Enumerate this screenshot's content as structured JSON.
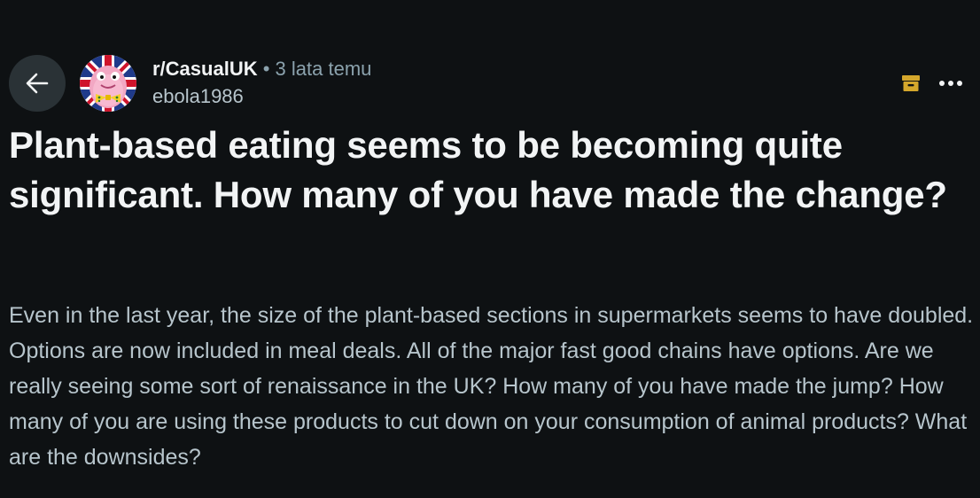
{
  "post": {
    "subreddit": "r/CasualUK",
    "separator": "•",
    "time": "3 lata temu",
    "author": "ebola1986",
    "title": "Plant-based eating seems to be becoming quite significant. How many of you have made the change?",
    "body": "Even in the last year, the size of the plant-based sections in supermarkets seems to have doubled. Options are now included in meal deals. All of the major fast good chains have options. Are we really seeing some sort of renaissance in the UK? How many of you have made the jump? How many of you are using these products to cut down on your consumption of animal products? What are the downsides?"
  },
  "icons": {
    "back": "arrow-left-icon",
    "archive": "archive-icon",
    "more": "more-horizontal-icon"
  },
  "colors": {
    "background": "#0e1113",
    "archive_accent": "#d4a72c",
    "back_button_bg": "#2a3236",
    "secondary_text": "#b7c5cc"
  }
}
